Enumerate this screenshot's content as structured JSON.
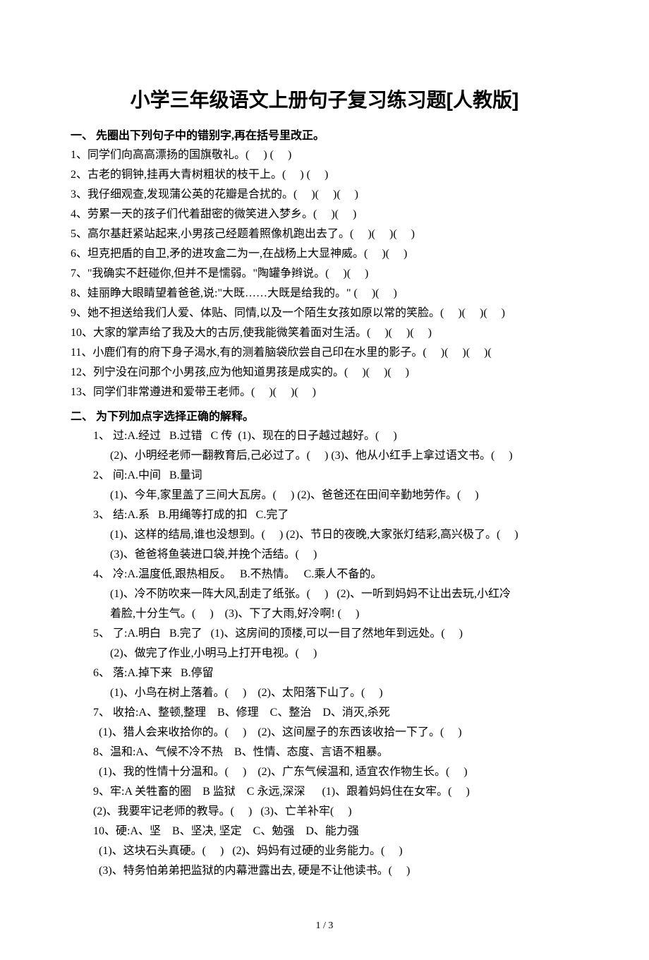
{
  "title": "小学三年级语文上册句子复习练习题[人教版]",
  "section1": {
    "head": "一、 先圈出下列句子中的错别字,再在括号里改正。",
    "items": [
      "1、同学们向高高漂扬的国旗敬礼。(     ) (     )",
      "2、古老的铜钟,挂再大青树粗状的枝干上。(     ) (     )",
      "3、我仔细观查,发现蒲公英的花瓣是合扰的。(     )(     )(     )",
      "4、劳累一天的孩子们代着甜密的微笑进入梦乡。(     )(     )",
      "5、高尔基赶紧站起来,小男孩己经题着照像机跑出去了。(     )(     )(     )",
      "6、坦克把盾的自卫,矛的进攻盒二为一,在战杨上大显神威。(     )(     )",
      "7、\"我确实不赶碰你,但并不是懦弱。\"陶罐争辫说。(     )(     )",
      "8、娃丽睁大眼睛望着爸爸,说:\"大既……大既是给我的。\" (     )(     )",
      "9、她不担送给我们人爱、体贴、同情,以及一个陌生女孩如原以常的笑脸。(     )(     )(     )",
      "10、大家的掌声给了我及大的古厉,使我能微笑着面对生活。(     )(     )(     )",
      "11、小鹿们有的府下身子渴水,有的测着脑袋欣尝自己印在水里的影子。(     )(     )(     )(",
      "12、列宁没在问那个小男孩,应为他知道男孩是成实的。(     )(     )(     )",
      "13、同学们非常遵进和爱带王老师。(     )(     )(     )"
    ]
  },
  "section2": {
    "head": "二、 为下列加点字选择正确的解释。",
    "groups": [
      {
        "lines": [
          {
            "t": "1、 过:A.经过   B.过错   C 传  (1)、现在的日子越过越好。(     )",
            "cls": "indent1"
          },
          {
            "t": "(2)、小明经老师一翻教育后,己必过了。(     ) (3)、他从小红手上拿过语文书。(     )",
            "cls": "indent2"
          }
        ]
      },
      {
        "lines": [
          {
            "t": "2、 间:A.中间   B.量词",
            "cls": "indent1"
          },
          {
            "t": "(1)、今年,家里盖了三间大瓦房。(     ) (2)、爸爸还在田间辛勤地劳作。(     )",
            "cls": "indent2"
          }
        ]
      },
      {
        "lines": [
          {
            "t": "3、 结:A.系   B.用绳等打成的扣   C.完了",
            "cls": "indent1"
          },
          {
            "t": "(1)、这样的结局,谁也没想到。(     ) (2)、节日的夜晚,大家张灯结彩,高兴极了。(     )",
            "cls": "indent2"
          },
          {
            "t": "(3)、爸爸将鱼装进口袋,并挽个活结。(     )",
            "cls": "indent2"
          }
        ]
      },
      {
        "lines": [
          {
            "t": "4、 冷:A.温度低,跟热相反。   B.不热情。   C.乘人不备的。",
            "cls": "indent1"
          },
          {
            "t": "(1)、冷不防吹来一阵大风,刮走了纸张。(     )   (2)、一听到妈妈不让出去玩,小红冷",
            "cls": "indent2"
          },
          {
            "t": "着脸,十分生气。(     )    (3)、下了大雨,好冷啊! (     )",
            "cls": "indent2"
          }
        ]
      },
      {
        "lines": [
          {
            "t": "5、 了:A.明白   B.完了   (1)、这房间的顶楼,可以一目了然地年到远处。(     )",
            "cls": "indent1"
          },
          {
            "t": "(2)、做完了作业,小明马上打开电视。(     )",
            "cls": "indent2"
          }
        ]
      },
      {
        "lines": [
          {
            "t": "6、 落:A.掉下来   B.停留",
            "cls": "indent1"
          },
          {
            "t": "(1)、小鸟在树上落着。(     )    (2)、太阳落下山了。(     )",
            "cls": "indent2"
          }
        ]
      },
      {
        "lines": [
          {
            "t": "7、 收拾:A、整顿,整理    B、修理    C、整治    D、消灭,杀死",
            "cls": "indent1"
          },
          {
            "t": "(1)、猎人会来收拾你的。(     )    (2)、这间屋子的东西该收拾一下了。(     )",
            "cls": "indent3"
          }
        ]
      },
      {
        "lines": [
          {
            "t": "8、温和:A、气候不冷不热    B、性情、态度、言语不粗暴。",
            "cls": "indent1"
          },
          {
            "t": "(1)、我的性情十分温和。(     )    (2)、广东气候温和, 适宜农作物生长。(     )",
            "cls": "indent3"
          }
        ]
      },
      {
        "lines": [
          {
            "t": "9、牢:A 关牲畜的圈    B 监狱    C 永远,深深      (1)、跟着妈妈住在女牢。(     )",
            "cls": "indent1"
          },
          {
            "t": "(2)、我要牢记老师的教导。(     )   (3)、亡羊补牢(     )",
            "cls": "indent1"
          }
        ]
      },
      {
        "lines": [
          {
            "t": "10、硬:A、坚    B、坚决, 坚定    C、勉强    D、能力强",
            "cls": "indent1"
          },
          {
            "t": "(1)、这块石头真硬。(     )   (2)、妈妈有过硬的业务能力。(     )",
            "cls": "indent3"
          },
          {
            "t": "(3)、特务怕弟弟把监狱的内幕泄露出去, 硬是不让他读书。(     )",
            "cls": "indent3"
          }
        ]
      }
    ]
  },
  "footer": "1 / 3"
}
